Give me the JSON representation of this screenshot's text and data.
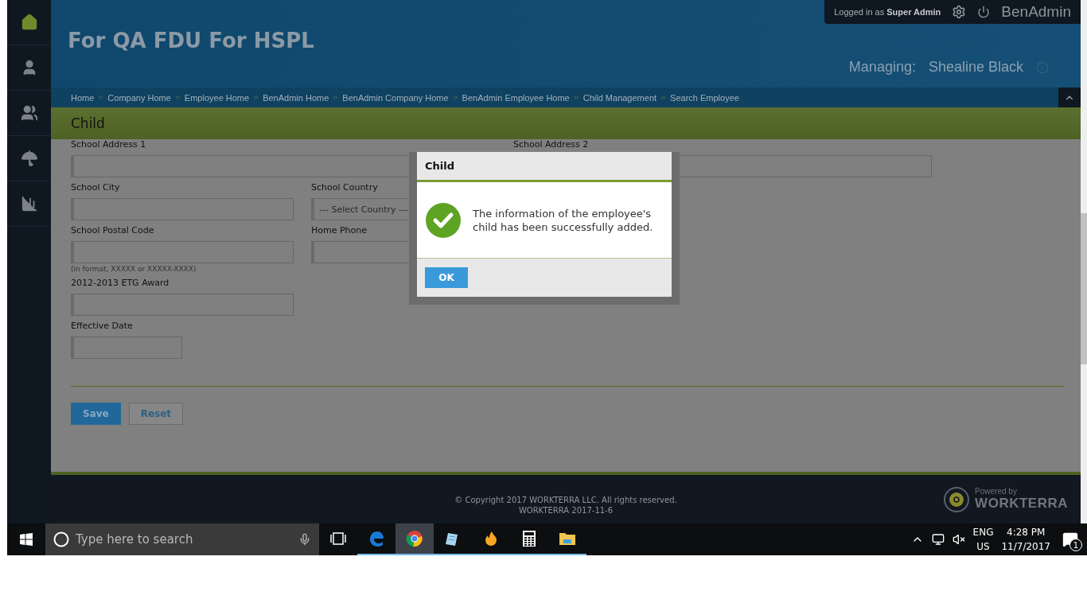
{
  "sidebar": {
    "items": [
      {
        "kind": "home",
        "selected": true
      },
      {
        "kind": "person",
        "selected": false
      },
      {
        "kind": "people",
        "selected": false
      },
      {
        "kind": "benefits",
        "selected": false
      },
      {
        "kind": "reports",
        "selected": false
      }
    ]
  },
  "header": {
    "title": "For QA FDU For HSPL",
    "login": "Logged in as **Super Admin**",
    "app_name": "BenAdmin",
    "managing_label": "Managing:",
    "managing_name": "Shealine Black"
  },
  "breadcrumbs": [
    "Home",
    "Company Home",
    "Employee Home",
    "BenAdmin Home",
    "BenAdmin Company Home",
    "BenAdmin Employee Home",
    "Child Management",
    "Search Employee"
  ],
  "page_title": "Child",
  "form": {
    "rows": [
      [
        {
          "label": "School Address 1",
          "kind": "text"
        },
        {
          "label": "School Address 2",
          "kind": "text"
        }
      ],
      [
        {
          "label": "School City",
          "kind": "text"
        },
        {
          "label": "School Country",
          "kind": "select",
          "value": "--- Select Country ---"
        }
      ],
      [
        {
          "label": "School Postal Code",
          "kind": "text",
          "hint": "(in format, XXXXX or XXXXX-XXXX)"
        },
        {
          "label": "Home Phone",
          "kind": "text"
        }
      ],
      [
        {
          "label": "2012-2013 ETG Award",
          "kind": "text"
        }
      ],
      [
        {
          "label": "Effective Date",
          "kind": "text"
        }
      ]
    ],
    "buttons": [
      {
        "label": "Save",
        "kind": "primary"
      },
      {
        "label": "Reset",
        "kind": "secondary"
      }
    ]
  },
  "dialog": {
    "title": "Child",
    "message": "The information of the employee's child has been successfully added.",
    "button": "OK"
  },
  "footer": {
    "copyright": "© Copyright 2017 WORKTERRA LLC. All rights reserved.",
    "build": "WORKTERRA 2017-11-6",
    "powered_by": "Powered by",
    "brand": "WORKTERRA"
  },
  "taskbar": {
    "search_placeholder": "Type here to search",
    "apps": [
      {
        "kind": "edge",
        "selected": false
      },
      {
        "kind": "chrome",
        "selected": true
      },
      {
        "kind": "notepad",
        "selected": false
      },
      {
        "kind": "flame",
        "selected": false
      },
      {
        "kind": "calculator",
        "selected": false
      },
      {
        "kind": "folder",
        "selected": false
      }
    ],
    "language": "ENG",
    "region": "US",
    "time": "4:28 PM",
    "date": "11/7/2017",
    "notifications": "1"
  }
}
